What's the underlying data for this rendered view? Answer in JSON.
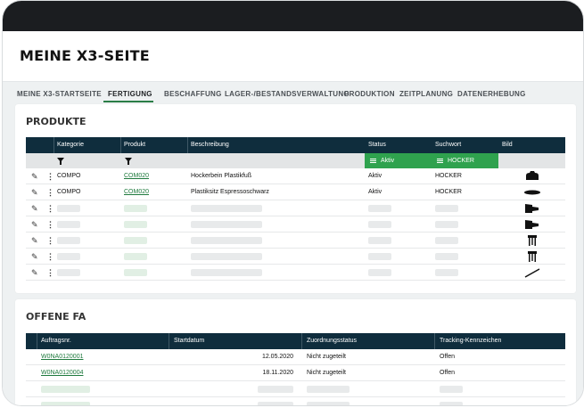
{
  "page": {
    "title": "MEINE X3-SEITE"
  },
  "tabs": [
    {
      "label": "MEINE X3-STARTSEITE"
    },
    {
      "label": "FERTIGUNG"
    },
    {
      "label": "BESCHAFFUNG"
    },
    {
      "label": "LAGER-/BESTANDSVERWALTUNG"
    },
    {
      "label": "PRODUKTION"
    },
    {
      "label": "ZEITPLANUNG"
    },
    {
      "label": "DATENERHEBUNG"
    }
  ],
  "active_tab": "FERTIGUNG",
  "produkte": {
    "title": "PRODUKTE",
    "columns": [
      "Kategorie",
      "Produkt",
      "Beschreibung",
      "Status",
      "Suchwort",
      "Bild"
    ],
    "filters": {
      "status": "Aktiv",
      "suchwort": "HOCKER"
    },
    "rows": [
      {
        "kategorie": "COMPO",
        "produkt": "COM020",
        "beschreibung": "Hockerbein Plastikfuß",
        "status": "Aktiv",
        "suchwort": "HOCKER",
        "bild": "stool-foot-icon"
      },
      {
        "kategorie": "COMPO",
        "produkt": "COM020",
        "beschreibung": "Plastiksitz Espressoschwarz",
        "status": "Aktiv",
        "suchwort": "HOCKER",
        "bild": "seat-disc-icon"
      }
    ],
    "placeholder_thumbs": [
      "screw-icon",
      "screw-icon",
      "stool-icon",
      "stool-icon",
      "rod-icon"
    ]
  },
  "offene_fa": {
    "title": "OFFENE FA",
    "columns": [
      "Auftragsnr.",
      "Startdatum",
      "Zuordnungsstatus",
      "Tracking-Kennzeichen"
    ],
    "rows": [
      {
        "auftragsnr": "W0NA0120001",
        "startdatum": "12.05.2020",
        "zuordnungsstatus": "Nicht zugeteilt",
        "tracking": "Offen"
      },
      {
        "auftragsnr": "W0NA0120004",
        "startdatum": "18.11.2020",
        "zuordnungsstatus": "Nicht zugeteilt",
        "tracking": "Offen"
      }
    ]
  },
  "colors": {
    "header_bg": "#0f2d3d",
    "accent_green": "#2fa24e",
    "link_green": "#1f7a3e",
    "topbar": "#1b1d20"
  }
}
